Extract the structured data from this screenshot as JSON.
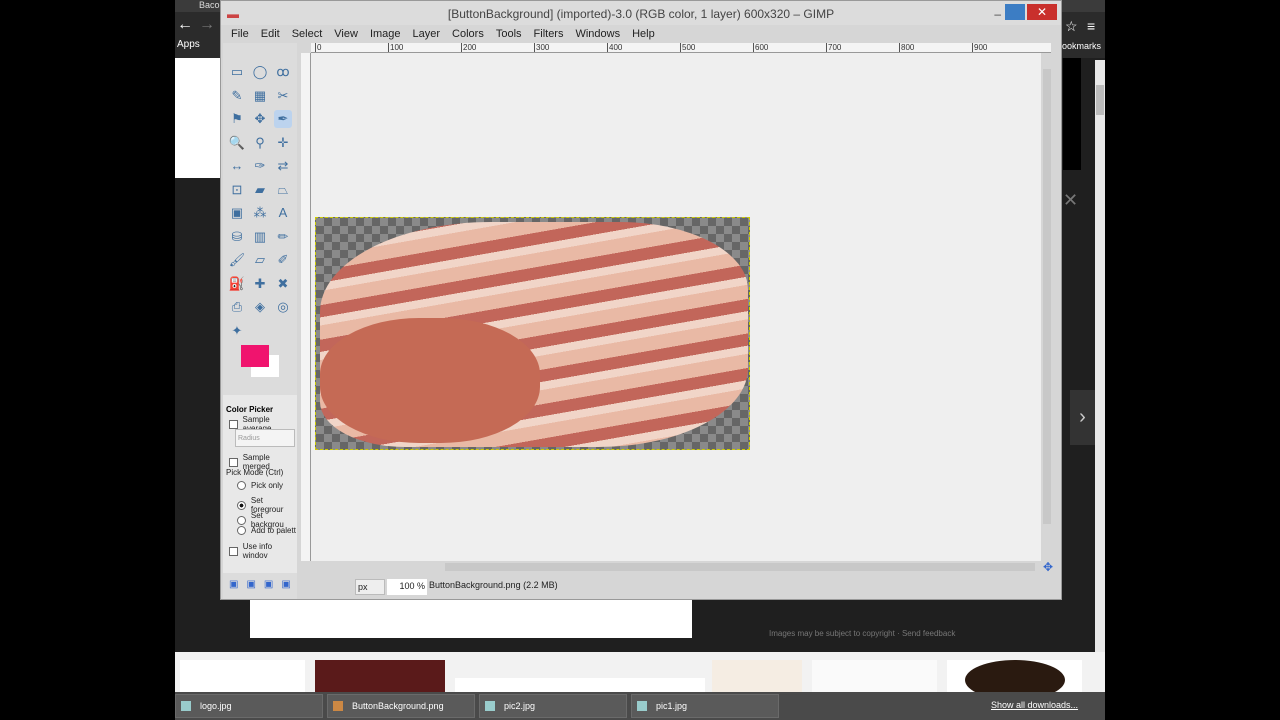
{
  "browser": {
    "tab_title": "Baco",
    "apps_label": "Apps",
    "bookmarks_label": "ookmarks",
    "copyright": "Images may be subject to copyright",
    "send_feedback": "Send feedback",
    "show_all_downloads": "Show all downloads...",
    "downloads": [
      {
        "name": "logo.jpg"
      },
      {
        "name": "ButtonBackground.png"
      },
      {
        "name": "pic2.jpg"
      },
      {
        "name": "pic1.jpg"
      }
    ]
  },
  "gimp": {
    "title": "[ButtonBackground] (imported)-3.0 (RGB color, 1 layer) 600x320 – GIMP",
    "menu": [
      "File",
      "Edit",
      "Select",
      "View",
      "Image",
      "Layer",
      "Colors",
      "Tools",
      "Filters",
      "Windows",
      "Help"
    ],
    "ruler_ticks": [
      "0",
      "100",
      "200",
      "300",
      "400",
      "500",
      "600",
      "700",
      "800",
      "900"
    ],
    "foreground_color": "#f0146e",
    "tool_options": {
      "title": "Color Picker",
      "sample_average": "Sample average",
      "radius_placeholder": "Radius",
      "sample_merged": "Sample merged",
      "pick_mode": "Pick Mode  (Ctrl)",
      "modes": [
        {
          "label": "Pick only",
          "selected": false
        },
        {
          "label": "Set foregrour",
          "selected": true
        },
        {
          "label": "Set backgrou",
          "selected": false
        },
        {
          "label": "Add to palett",
          "selected": false
        }
      ],
      "use_info_window": "Use info windov"
    },
    "status": {
      "unit": "px",
      "zoom": "100 %",
      "file": "ButtonBackground.png (2.2 MB)"
    }
  }
}
